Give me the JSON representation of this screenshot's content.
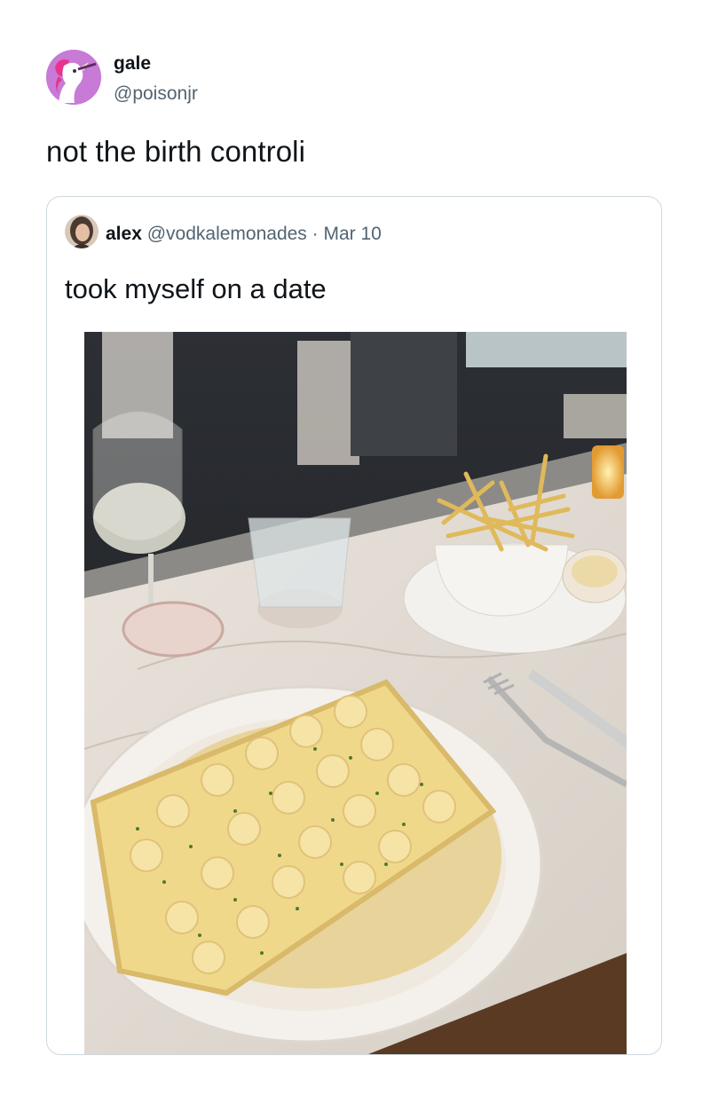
{
  "tweet": {
    "author_name": "gale",
    "author_handle": "@poisonjr",
    "text": "not the birth controli"
  },
  "quoted_tweet": {
    "author_name": "alex",
    "author_handle": "@vodkalemonades",
    "separator": "·",
    "date": "Mar 10",
    "text": "took myself on a date"
  },
  "colors": {
    "text_primary": "#0f1419",
    "text_secondary": "#536471",
    "card_border": "#cfd9de",
    "avatar_bg": "#c77ad6"
  }
}
